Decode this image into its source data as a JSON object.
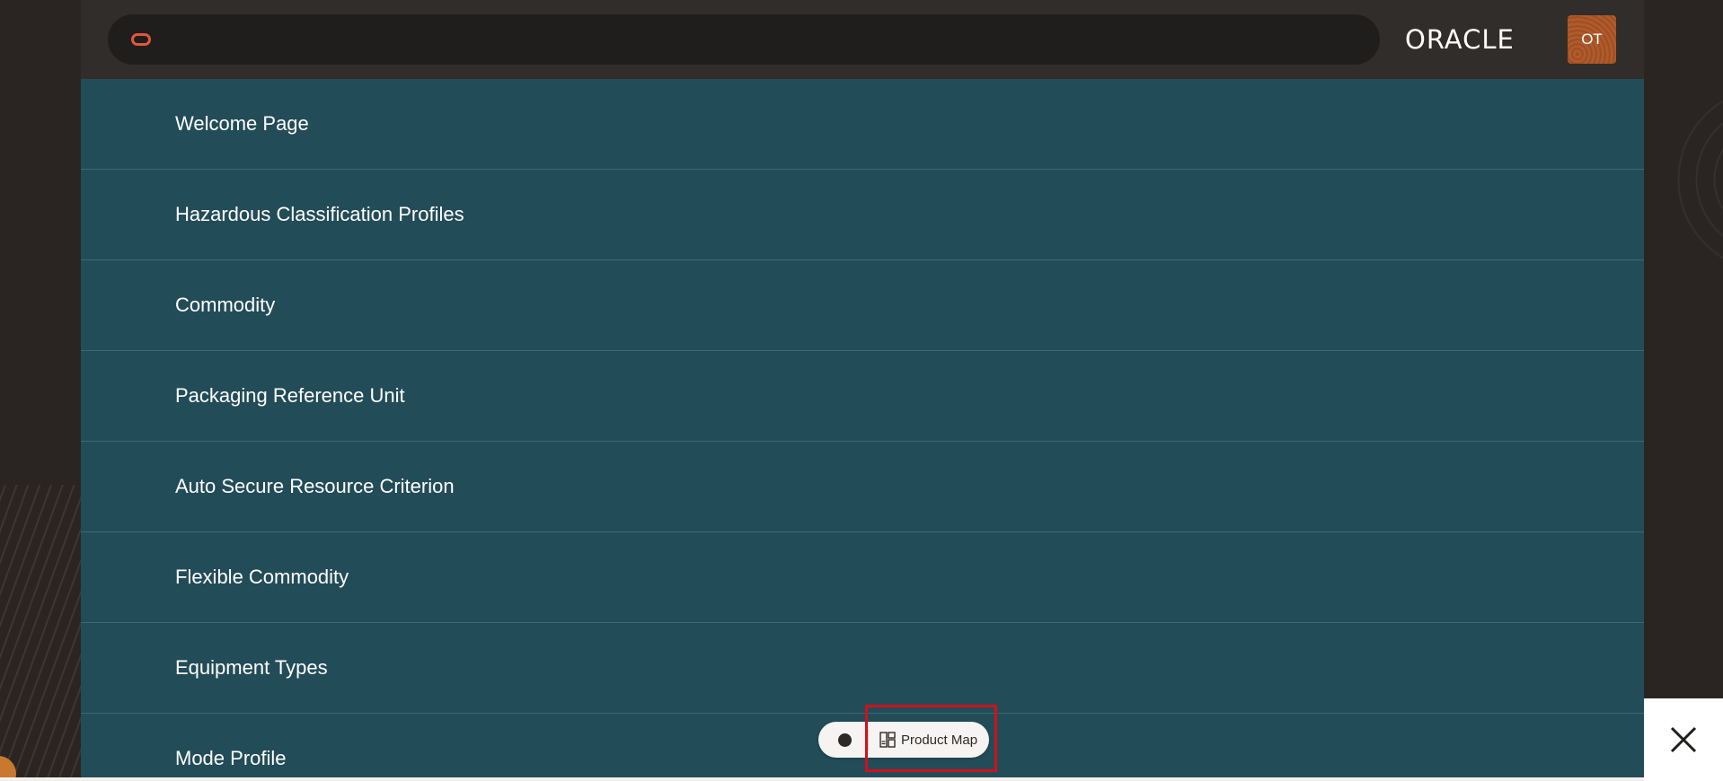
{
  "header": {
    "brand": "ORACLE",
    "avatar_initials": "OT",
    "search_icon": "oracle-o-icon"
  },
  "menu": {
    "items": [
      {
        "label": "Welcome Page"
      },
      {
        "label": "Hazardous Classification Profiles"
      },
      {
        "label": "Commodity"
      },
      {
        "label": "Packaging Reference Unit"
      },
      {
        "label": "Auto Secure Resource Criterion"
      },
      {
        "label": "Flexible Commodity"
      },
      {
        "label": "Equipment Types"
      },
      {
        "label": "Mode Profile"
      }
    ]
  },
  "floating_bar": {
    "product_map_label": "Product Map",
    "product_map_icon": "product-map-icon"
  },
  "close": {
    "icon": "close-icon"
  },
  "colors": {
    "menu_background": "#234c59",
    "header_background": "#312d2a",
    "search_background": "#201e1c",
    "accent": "#e2563e",
    "avatar": "#b15a2b",
    "highlight": "#d0111b"
  }
}
